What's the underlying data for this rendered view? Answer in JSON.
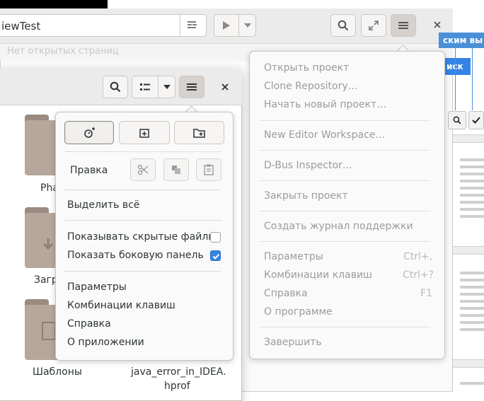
{
  "builder": {
    "project_title": "iewTest",
    "no_pages_text": "Нет открытых страниц",
    "menu": {
      "items": [
        {
          "label": "Открыть проект"
        },
        {
          "label": "Clone Repository…"
        },
        {
          "label": "Начать новый проект…"
        },
        {
          "label": "New Editor Workspace…"
        },
        {
          "label": "D-Bus Inspector…"
        },
        {
          "label": "Закрыть проект"
        },
        {
          "label": "Создать журнал поддержки"
        },
        {
          "label": "Параметры",
          "accel": "Ctrl+,"
        },
        {
          "label": "Комбинации клавиш",
          "accel": "Ctrl+?"
        },
        {
          "label": "Справка",
          "accel": "F1"
        },
        {
          "label": "О программе"
        },
        {
          "label": "Завершить"
        }
      ]
    }
  },
  "right_window": {
    "strip_text": "ским вы",
    "button_text": "иск"
  },
  "files": {
    "items": [
      {
        "label": "Pha"
      },
      {
        "label": "Загр"
      },
      {
        "label": "Шаблоны"
      },
      {
        "label": "java_error_in_IDEA."
      },
      {
        "label": "hprof"
      }
    ],
    "menu": {
      "edit_label": "Правка",
      "select_all": "Выделить всё",
      "show_hidden": {
        "label": "Показывать скрытые файлы",
        "checked": false
      },
      "show_sidebar": {
        "label": "Показать боковую панель",
        "checked": true
      },
      "preferences": "Параметры",
      "shortcuts": "Комбинации клавиш",
      "help": "Справка",
      "about": "О приложении"
    }
  },
  "colors": {
    "accent": "#3584e4"
  }
}
